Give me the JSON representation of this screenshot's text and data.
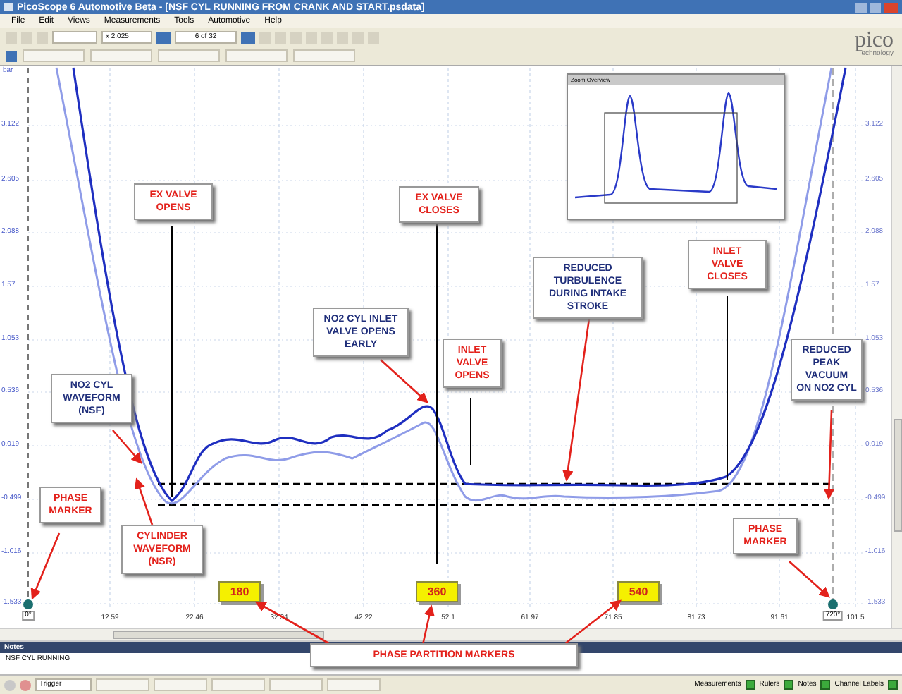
{
  "window": {
    "title": "PicoScope 6 Automotive Beta - [NSF CYL RUNNING FROM CRANK AND START.psdata]"
  },
  "menu": [
    "File",
    "Edit",
    "Views",
    "Measurements",
    "Tools",
    "Automotive",
    "Help"
  ],
  "toolbar": {
    "zoom": "x 2.025",
    "buffer": "6 of 32"
  },
  "logo": {
    "name": "pico",
    "tagline": "Technology"
  },
  "chart": {
    "y_unit": "bar",
    "y_labels": [
      "3.122",
      "2.605",
      "2.088",
      "1.57",
      "1.053",
      "0.536",
      "0.019",
      "-0.499",
      "-1.016",
      "-1.533"
    ],
    "right_y_labels": [
      "3.122",
      "2.605",
      "2.088",
      "1.57",
      "1.053",
      "0.536",
      "0.019",
      "-0.499",
      "-1.016",
      "-1.533"
    ],
    "x_labels": [
      "12.59",
      "22.46",
      "32.34",
      "42.22",
      "52.1",
      "61.97",
      "71.85",
      "81.73",
      "91.61",
      "101.5"
    ],
    "phase_labels": [
      "0°",
      "720°"
    ],
    "partition_markers": [
      "180",
      "360",
      "540"
    ],
    "overview": {
      "title": "Zoom Overview"
    }
  },
  "callouts": [
    {
      "lines": [
        "EX VALVE",
        "OPENS"
      ],
      "color": "#e3211b"
    },
    {
      "lines": [
        "EX VALVE",
        "CLOSES"
      ],
      "color": "#e3211b"
    },
    {
      "lines": [
        "INLET",
        "VALVE",
        "CLOSES"
      ],
      "color": "#e3211b"
    },
    {
      "lines": [
        "REDUCED",
        "TURBULENCE",
        "DURING INTAKE",
        "STROKE"
      ],
      "color": "#1f2e7a"
    },
    {
      "lines": [
        "NO2 CYL INLET",
        "VALVE OPENS",
        "EARLY"
      ],
      "color": "#1f2e7a"
    },
    {
      "lines": [
        "INLET",
        "VALVE",
        "OPENS"
      ],
      "color": "#e3211b"
    },
    {
      "lines": [
        "NO2 CYL",
        "WAVEFORM",
        "(NSF)"
      ],
      "color": "#1f2e7a"
    },
    {
      "lines": [
        "REDUCED",
        "PEAK",
        "VACUUM",
        "ON NO2 CYL"
      ],
      "color": "#1f2e7a"
    },
    {
      "lines": [
        "PHASE",
        "MARKER"
      ],
      "color": "#e3211b"
    },
    {
      "lines": [
        "CYLINDER",
        "WAVEFORM",
        "(NSR)"
      ],
      "color": "#e3211b"
    },
    {
      "lines": [
        "PHASE",
        "MARKER"
      ],
      "color": "#e3211b"
    },
    {
      "lines": [
        "PHASE PARTITION MARKERS"
      ],
      "color": "#e3211b"
    }
  ],
  "notes": {
    "title": "Notes",
    "text": "NSF CYL RUNNING"
  },
  "status_bar": {
    "trigger": "Trigger",
    "toggles": [
      "Measurements",
      "Rulers",
      "Notes",
      "Channel Labels"
    ]
  }
}
